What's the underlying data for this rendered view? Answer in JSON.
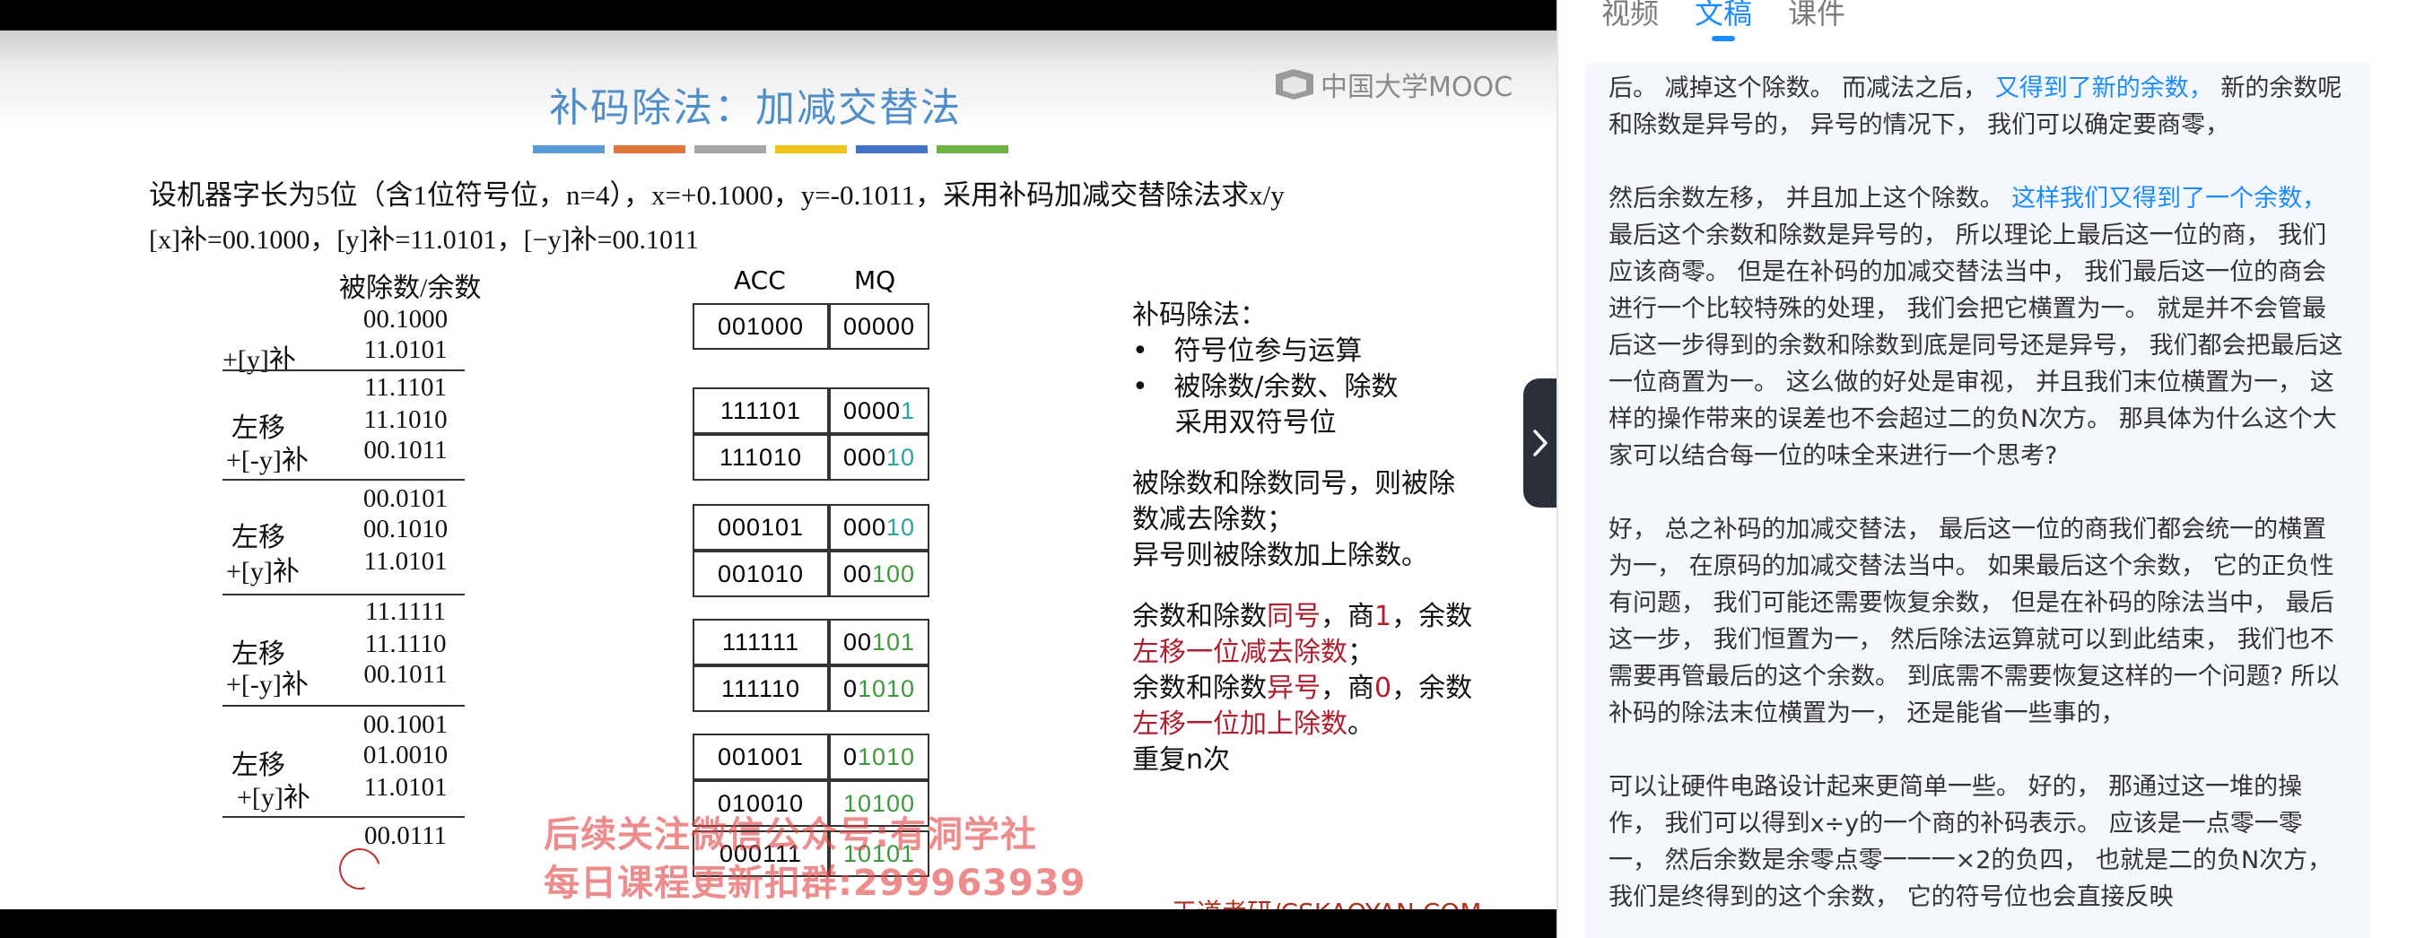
{
  "slide": {
    "title": "补码除法：加减交替法",
    "logo_text": "中国大学MOOC",
    "color_bars": [
      "#5b9bd5",
      "#e0763a",
      "#a5a5a5",
      "#f0c419",
      "#4472c4",
      "#6fb244"
    ],
    "problem": "设机器字长为5位（含1位符号位，n=4），x=+0.1000，y=-0.1011，采用补码加减交替除法求x/y",
    "values_line": "[x]补=00.1000，[y]补=11.0101，[−y]补=00.1011",
    "left_header": "被除数/余数",
    "left_numbers": [
      "00.1000",
      "11.0101",
      "11.1101",
      "11.1010",
      "00.1011",
      "00.0101",
      "00.1010",
      "11.0101",
      "11.1111",
      "11.1110",
      "00.1011",
      "00.1001",
      "01.0010",
      "11.0101",
      "00.0111"
    ],
    "left_ops": {
      "add_y": "+[y]补",
      "add_neg_y": "+[-y]补",
      "shift": "左移"
    },
    "acc_header": "ACC",
    "mq_header": "MQ",
    "acc": [
      "001000",
      "111101",
      "111010",
      "000101",
      "001010",
      "111111",
      "111110",
      "001001",
      "010010",
      "000111"
    ],
    "mq_plain": [
      "00000",
      "0000",
      "000",
      "000",
      "00",
      "00",
      "0",
      "0",
      "",
      ""
    ],
    "mq_color": [
      "",
      "1",
      "10",
      "10",
      "100",
      "101",
      "1010",
      "1010",
      "10100",
      "10101"
    ],
    "explain": {
      "title": "补码除法：",
      "bullet1": "符号位参与运算",
      "bullet2": "被除数/余数、除数",
      "bullet2b": "采用双符号位",
      "rule1a": "被除数和除数同号，则被除",
      "rule1b": "数减去除数；",
      "rule1c": "异号则被除数加上除数。",
      "r2_a": "余数和除数",
      "r2_b": "同号",
      "r2_c": "，商",
      "r2_d": "1",
      "r2_e": "，余数",
      "r2_f": "左移一位减去除数",
      "r2_g": "；",
      "r3_a": "余数和除数",
      "r3_b": "异号",
      "r3_c": "，商",
      "r3_d": "0",
      "r3_e": "，余数",
      "r3_f": "左移一位加上除数",
      "r3_g": "。",
      "repeat": "重复n次"
    },
    "watermark_1": "后续关注微信公众号:有洞学社",
    "watermark_2": "每日课程更新扣群:299963939",
    "footer": "王道考研/CSKAOYAN.COM"
  },
  "panel": {
    "tabs": [
      "视频",
      "文稿",
      "课件"
    ],
    "active_tab": "文稿",
    "p1_a": "后。 减掉这个除数。 而减法之后，",
    "p1_hl": " 又得到了新的余数，",
    "p1_b": " 新的余数呢和除数是异号的， 异号的情况下， 我们可以确定要商零，",
    "p2_a": "然后余数左移， 并且加上这个除数。",
    "p2_hl": " 这样我们又得到了一个余数，",
    "p2_b": " 最后这个余数和除数是异号的， 所以理论上最后这一位的商， 我们应该商零。 但是在补码的加减交替法当中， 我们最后这一位的商会进行一个比较特殊的处理， 我们会把它横置为一。 就是并不会管最后这一步得到的余数和除数到底是同号还是异号， 我们都会把最后这一位商置为一。 这么做的好处是审视， 并且我们末位横置为一， 这样的操作带来的误差也不会超过二的负N次方。 那具体为什么这个大家可以结合每一位的味全来进行一个思考?",
    "p3": "好， 总之补码的加减交替法， 最后这一位的商我们都会统一的横置为一， 在原码的加减交替法当中。 如果最后这个余数， 它的正负性有问题， 我们可能还需要恢复余数， 但是在补码的除法当中， 最后这一步， 我们恒置为一， 然后除法运算就可以到此结束， 我们也不需要再管最后的这个余数。 到底需不需要恢复这样的一个问题? 所以补码的除法末位横置为一， 还是能省一些事的，",
    "p4": "可以让硬件电路设计起来更简单一些。 好的， 那通过这一堆的操作， 我们可以得到x÷y的一个商的补码表示。 应该是一点零一零一， 然后余数是余零点零一一一×2的负四， 也就是二的负N次方， 我们是终得到的这个余数， 它的符号位也会直接反映"
  }
}
